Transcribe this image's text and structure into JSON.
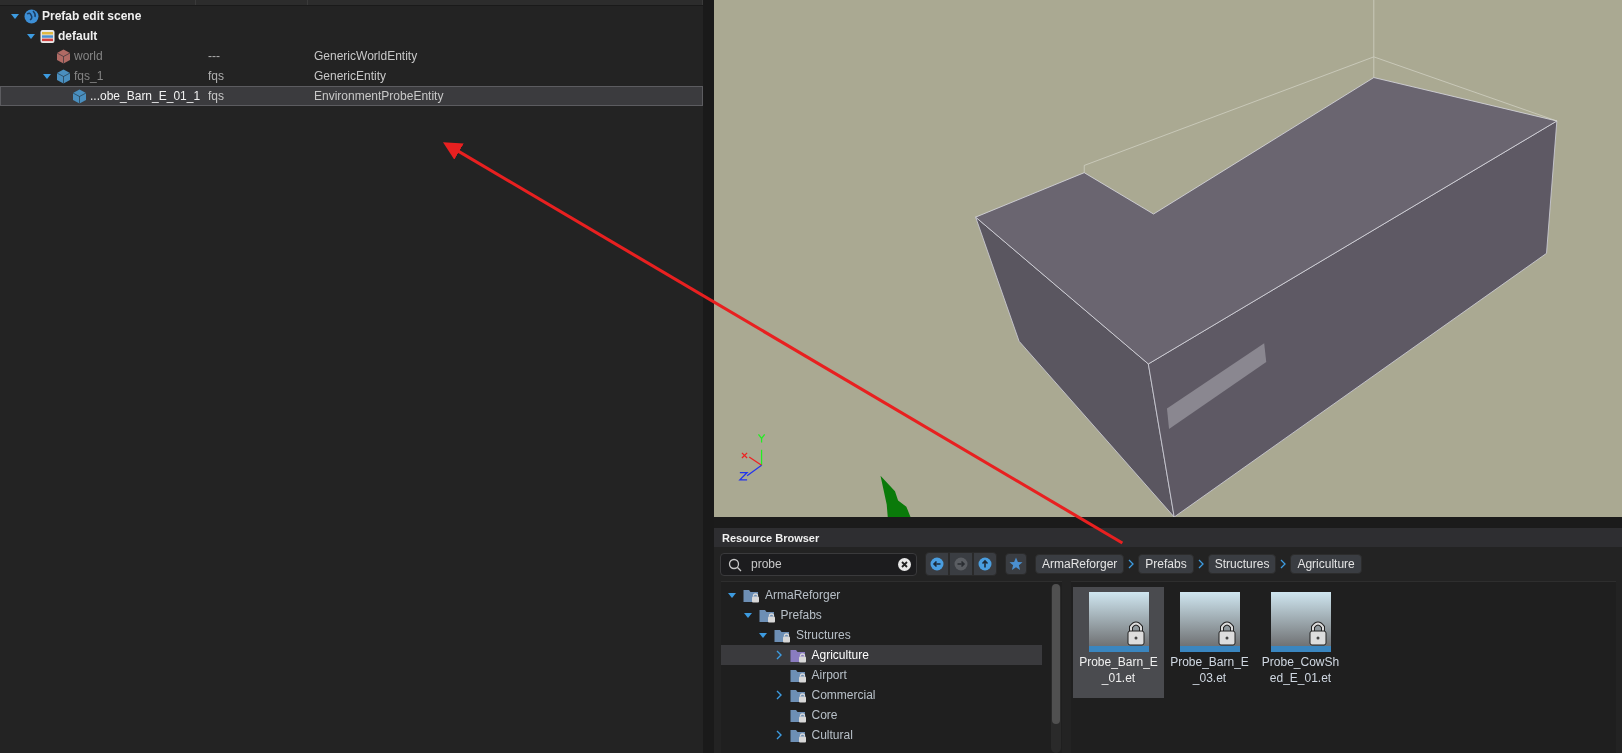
{
  "scene_hierarchy": {
    "items": [
      {
        "kind": "scene",
        "label": "Prefab edit scene",
        "expandable": true,
        "expanded": true,
        "selected": false,
        "inactive": false,
        "children": [
          {
            "kind": "layer",
            "label": "default",
            "expandable": true,
            "expanded": true,
            "selected": false,
            "inactive": false,
            "children": [
              {
                "kind": "entity",
                "label": "world",
                "column_2": "---",
                "column_3": "GenericWorldEntity",
                "color": "#b06a64",
                "expandable": false,
                "selected": false,
                "inactive": true
              },
              {
                "kind": "entity",
                "label": "fqs_1",
                "column_2": "fqs",
                "column_3": "GenericEntity",
                "color": "#4a8fbf",
                "expandable": true,
                "expanded": true,
                "selected": false,
                "inactive": true,
                "children": [
                  {
                    "kind": "entity",
                    "label": "...obe_Barn_E_01_1",
                    "column_2": "fqs",
                    "column_3": "EnvironmentProbeEntity",
                    "color": "#4a8fbf",
                    "expandable": false,
                    "selected": true,
                    "inactive": false
                  }
                ]
              }
            ]
          }
        ]
      }
    ]
  },
  "resource_browser": {
    "title": "Resource Browser",
    "search": {
      "value": "probe"
    },
    "nav_buttons": [
      {
        "kind": "back",
        "disabled": false
      },
      {
        "kind": "forward",
        "disabled": true
      },
      {
        "kind": "up",
        "disabled": false
      }
    ],
    "breadcrumb": [
      "ArmaReforger",
      "Prefabs",
      "Structures",
      "Agriculture"
    ],
    "folders": [
      {
        "label": "ArmaReforger",
        "expandable": true,
        "expanded": true,
        "selected": false,
        "color": "#6d8fb5",
        "children": [
          {
            "label": "Prefabs",
            "expandable": true,
            "expanded": true,
            "selected": false,
            "color": "#6d8fb5",
            "children": [
              {
                "label": "Structures",
                "expandable": true,
                "expanded": true,
                "selected": false,
                "color": "#6d8fb5",
                "children": [
                  {
                    "label": "Agriculture",
                    "expandable": true,
                    "expanded": false,
                    "selected": true,
                    "color": "#8a7cc0"
                  },
                  {
                    "label": "Airport",
                    "expandable": false,
                    "selected": false,
                    "color": "#6d8fb5"
                  },
                  {
                    "label": "Commercial",
                    "expandable": true,
                    "expanded": false,
                    "selected": false,
                    "color": "#6d8fb5"
                  },
                  {
                    "label": "Core",
                    "expandable": false,
                    "selected": false,
                    "color": "#6d8fb5"
                  },
                  {
                    "label": "Cultural",
                    "expandable": true,
                    "expanded": false,
                    "selected": false,
                    "color": "#6d8fb5"
                  }
                ]
              }
            ]
          }
        ]
      }
    ],
    "files": [
      {
        "name": "Probe_Barn_E_01.et",
        "selected": true,
        "locked": true
      },
      {
        "name": "Probe_Barn_E_03.et",
        "selected": false,
        "locked": true
      },
      {
        "name": "Probe_CowShed_E_01.et",
        "selected": false,
        "locked": true
      }
    ]
  }
}
